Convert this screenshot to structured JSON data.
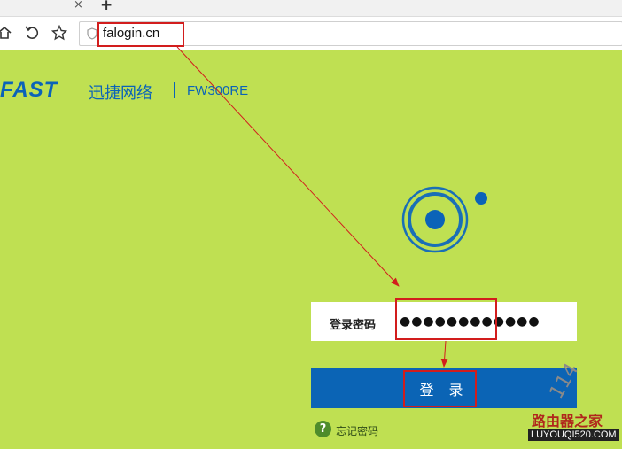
{
  "browser": {
    "tab_close_glyph": "×",
    "new_tab_glyph": "+",
    "address": "falogin.cn"
  },
  "brand": {
    "logo": "FAST",
    "name_cn": "迅捷网络",
    "model": "FW300RE"
  },
  "login": {
    "password_label": "登录密码",
    "password_value": "●●●●●●●●●●●●",
    "login_button": "登 录",
    "forgot_password": "忘记密码",
    "help_glyph": "?"
  },
  "watermark": {
    "number": "114",
    "site_cn": "路由器之家",
    "site_url": "LUYOUQI520.COM"
  },
  "colors": {
    "page_bg": "#bfe052",
    "brand_blue": "#0b63b8",
    "button_blue": "#0b64b5",
    "highlight_red": "#d21d1d"
  },
  "icons": [
    "home-icon",
    "back-icon",
    "star-icon",
    "shield-icon",
    "router-logo-icon",
    "help-icon"
  ]
}
